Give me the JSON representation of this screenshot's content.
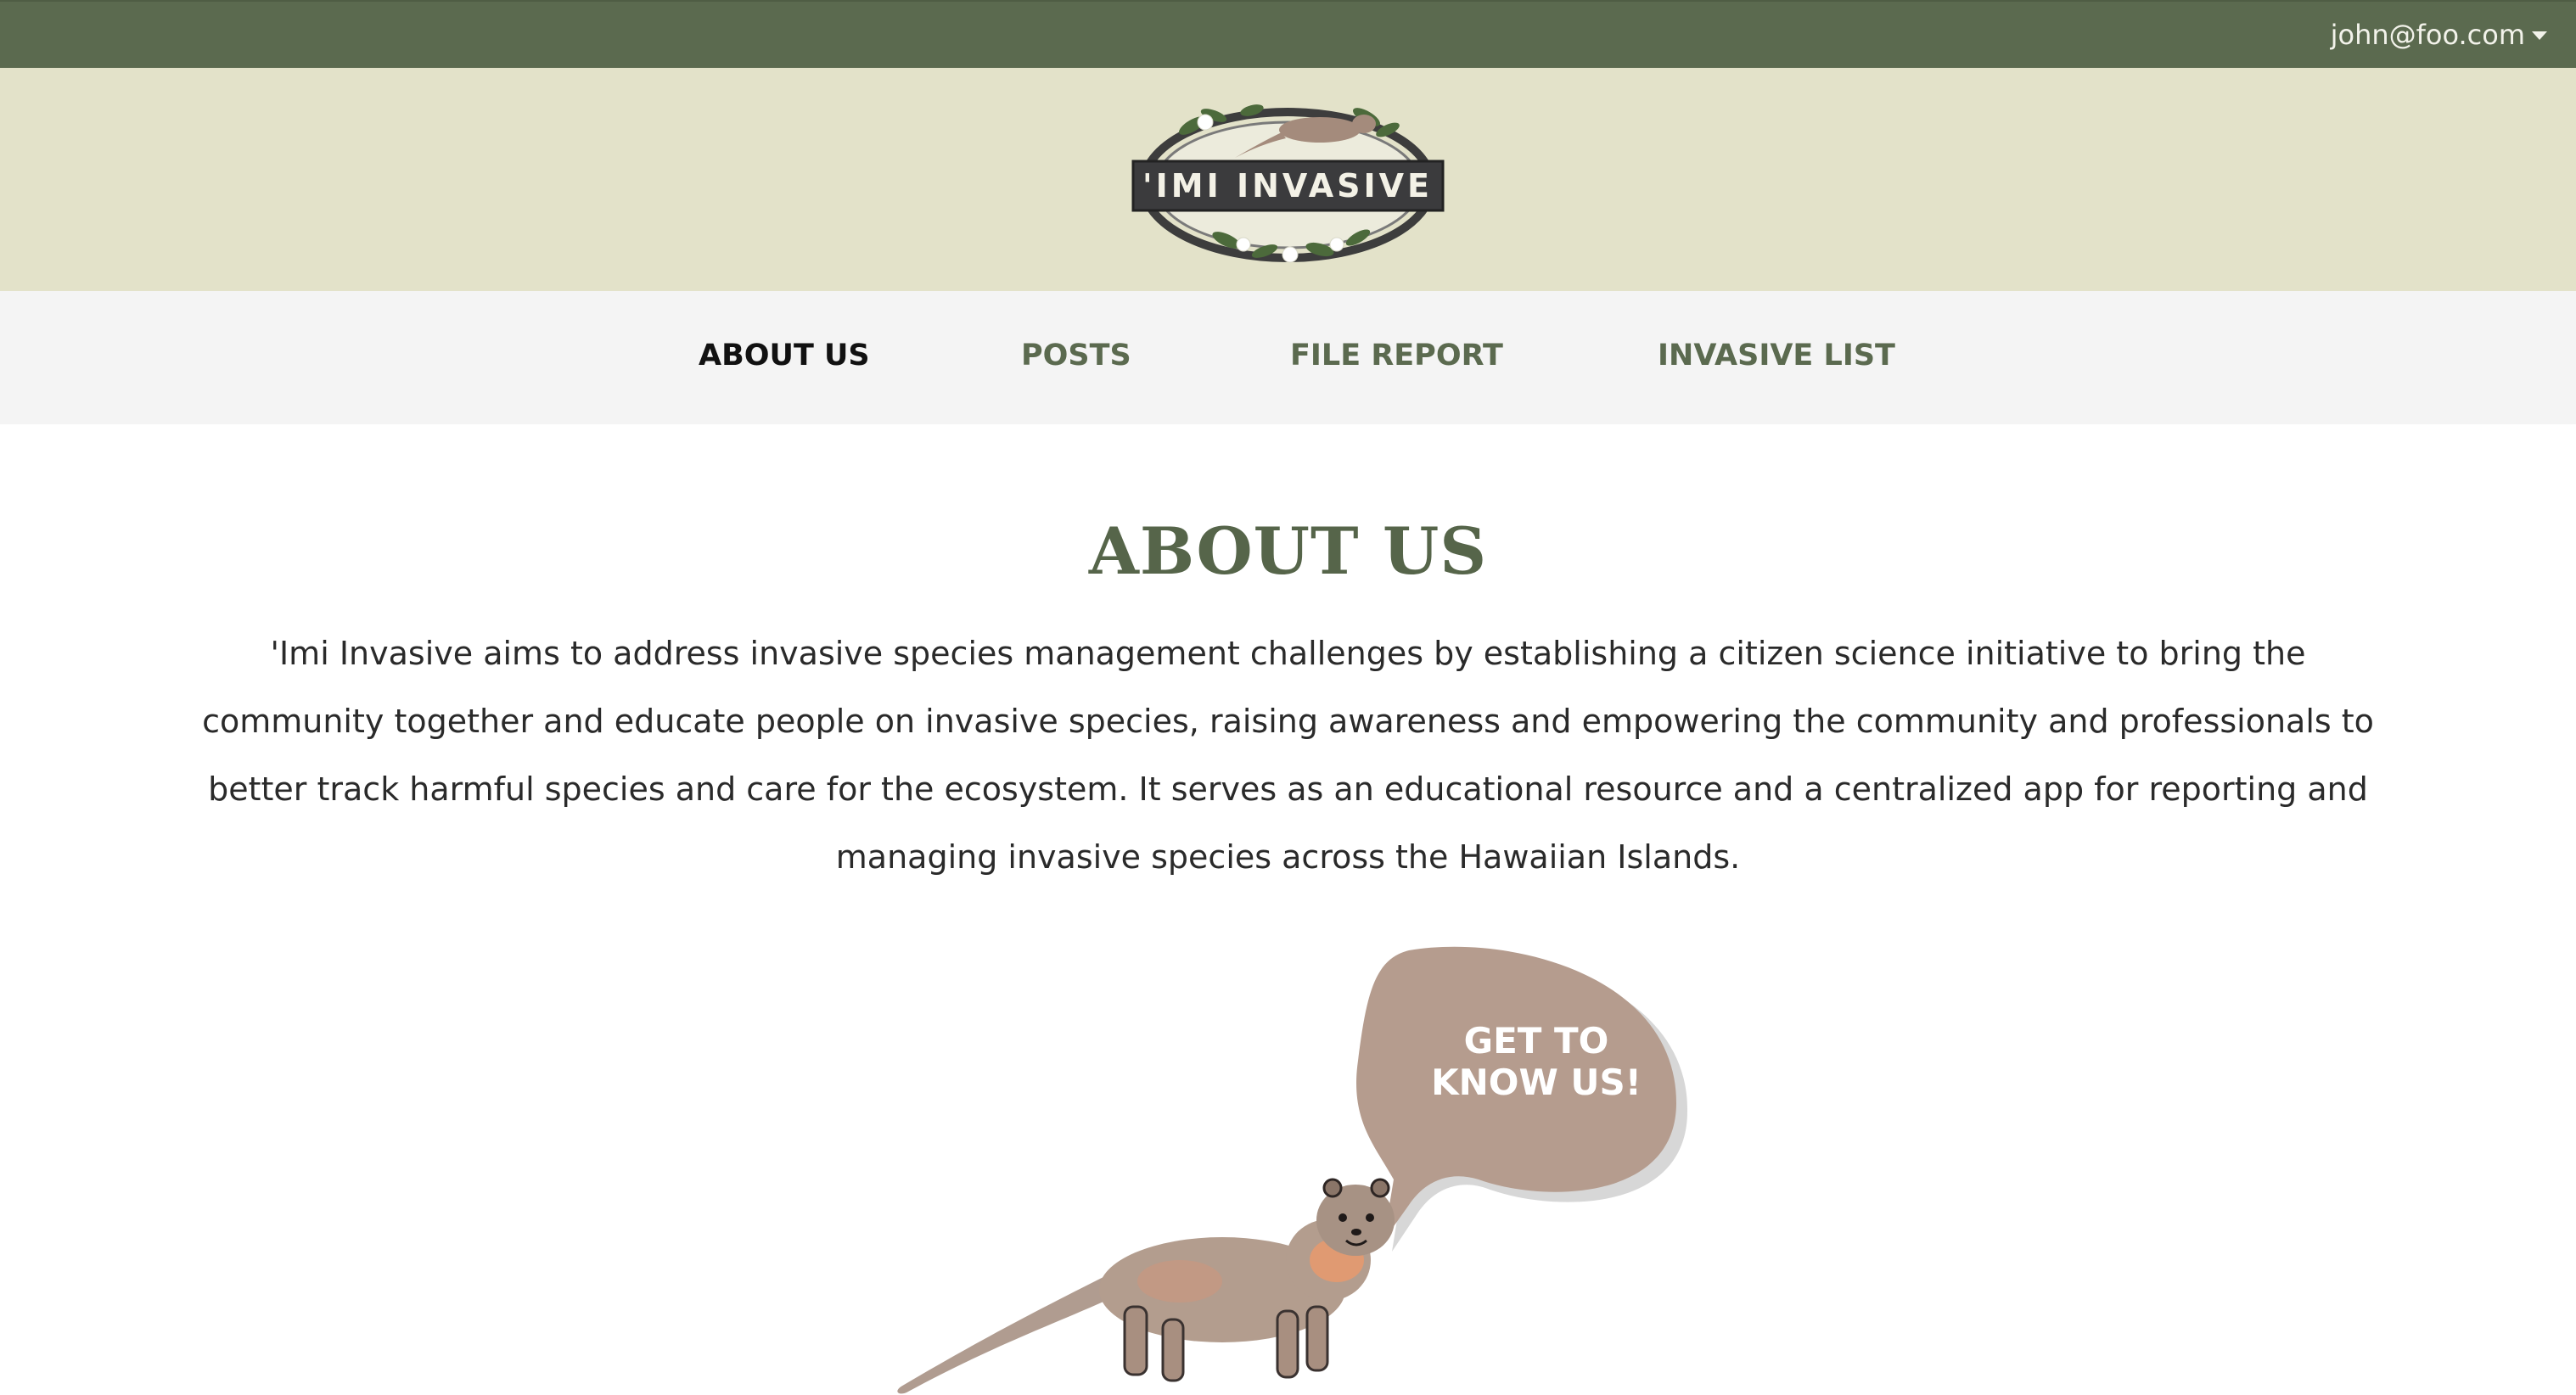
{
  "colors": {
    "topbar": "#5b6a4f",
    "logo_band": "#e3e2c9",
    "nav_bg": "#f4f4f4",
    "accent_green": "#56654a",
    "bubble": "#b59c8e"
  },
  "header": {
    "user_email": "john@foo.com",
    "user_menu_icon": "chevron-down-icon"
  },
  "logo": {
    "text": "'IMI INVASIVE"
  },
  "nav": {
    "items": [
      {
        "label": "ABOUT US",
        "active": true
      },
      {
        "label": "POSTS",
        "active": false
      },
      {
        "label": "FILE REPORT",
        "active": false
      },
      {
        "label": "INVASIVE LIST",
        "active": false
      }
    ]
  },
  "main": {
    "title": "ABOUT US",
    "intro": "'Imi Invasive aims to address invasive species management challenges by establishing a citizen science initiative to bring the community together and educate people on invasive species, raising awareness and empowering the community and professionals to better track harmful species and care for the ecosystem. It serves as an educational resource and a centralized app for reporting and managing invasive species across the Hawaiian Islands.",
    "bubble_line1": "GET TO",
    "bubble_line2": "KNOW US!"
  }
}
